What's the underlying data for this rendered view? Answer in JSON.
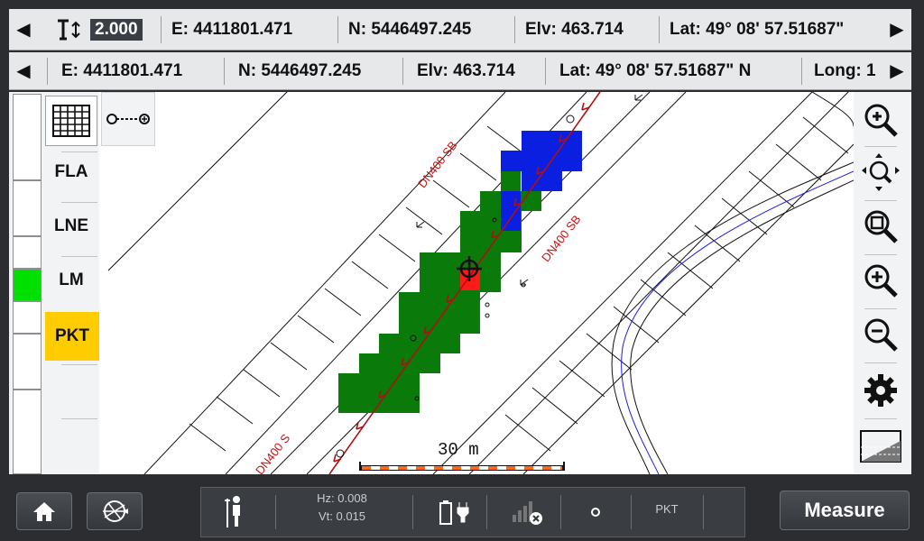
{
  "top_bar": {
    "height_label": "2.000",
    "easting": "E: 4411801.471",
    "northing": "N: 5446497.245",
    "elevation": "Elv: 463.714",
    "latitude": "Lat: 49° 08' 57.51687\""
  },
  "second_bar": {
    "easting": "E: 4411801.471",
    "northing": "N: 5446497.245",
    "elevation": "Elv: 463.714",
    "latitude": "Lat: 49° 08' 57.51687\" N",
    "longitude": "Long: 1"
  },
  "left_tabs": [
    "FLA",
    "LNE",
    "LM",
    "PKT"
  ],
  "active_tab_color": "#ffcc00",
  "map": {
    "pipe_label_1": "DN400 SB",
    "pipe_label_2": "DN400 SB",
    "pipe_label_3": "DN400 S",
    "scale_label": "30 m",
    "coverage_colors": {
      "green": "#0a7a0a",
      "blue": "#0a1fe0",
      "red": "#ff1a1a"
    }
  },
  "status": {
    "hz": "Hz: 0.008",
    "vt": "Vt: 0.015",
    "point_code": "PKT"
  },
  "bottom": {
    "measure_label": "Measure"
  },
  "icons": {
    "home": "home-icon",
    "compass": "compass-icon",
    "surveyor": "surveyor-icon",
    "battery": "battery-icon",
    "plug": "plug-icon",
    "signal": "signal-off-icon",
    "dot": "point-icon",
    "zoom_in": "zoom-in-icon",
    "pan": "pan-icon",
    "zoom_extent": "zoom-extent-icon",
    "zoom_plus": "zoom-plus-icon",
    "zoom_minus": "zoom-minus-icon",
    "settings": "gear-icon",
    "profile": "profile-icon",
    "grid": "grid-icon",
    "line_tool": "line-tool-icon"
  }
}
